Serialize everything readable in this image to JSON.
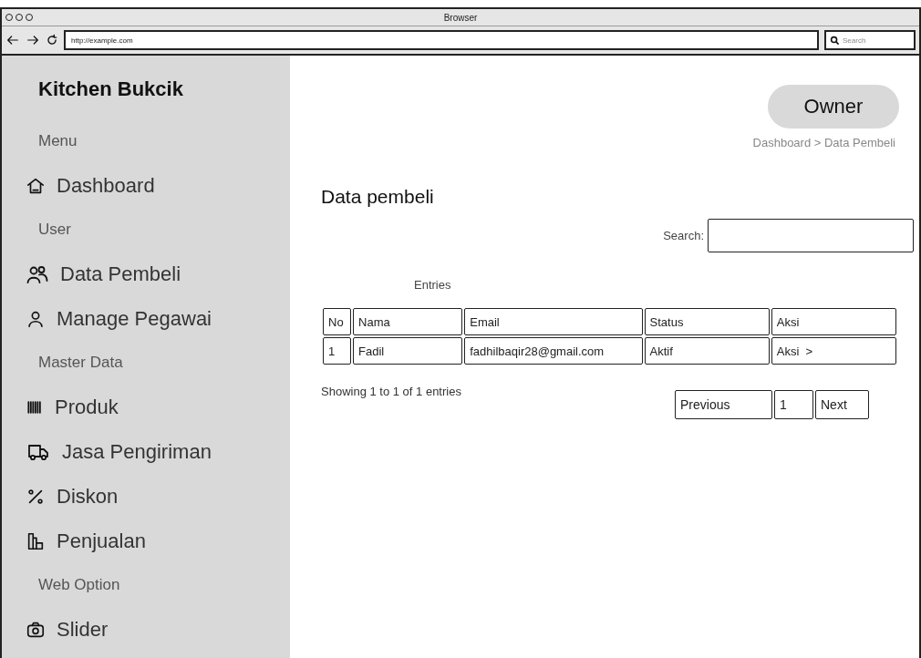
{
  "window": {
    "title": "Browser",
    "address": "http://example.com",
    "search_placeholder": "Search"
  },
  "sidebar": {
    "brand": "Kitchen Bukcik",
    "items": [
      {
        "kind": "section",
        "label": "Menu"
      },
      {
        "kind": "link",
        "label": "Dashboard"
      },
      {
        "kind": "section",
        "label": "User"
      },
      {
        "kind": "link",
        "label": "Data Pembeli"
      },
      {
        "kind": "link",
        "label": "Manage Pegawai"
      },
      {
        "kind": "section",
        "label": "Master Data"
      },
      {
        "kind": "link",
        "label": "Produk"
      },
      {
        "kind": "link",
        "label": "Jasa Pengiriman"
      },
      {
        "kind": "link",
        "label": "Diskon"
      },
      {
        "kind": "link",
        "label": "Penjualan"
      },
      {
        "kind": "section",
        "label": "Web Option"
      },
      {
        "kind": "link",
        "label": "Slider"
      }
    ]
  },
  "user_button": "Owner",
  "breadcrumb": "Dashboard > Data Pembeli",
  "page_title": "Data pembeli",
  "search_label": "Search:",
  "entries_label": "Entries",
  "table": {
    "columns": [
      "No",
      "Nama",
      "Email",
      "Status",
      "Aksi"
    ],
    "rows": [
      [
        "1",
        "Fadil",
        "fadhilbaqir28@gmail.com",
        "Aktif",
        "Aksi  >"
      ]
    ]
  },
  "summary": "Showing 1 to 1 of 1 entries",
  "pagination": [
    "Previous",
    "1",
    "Next"
  ]
}
